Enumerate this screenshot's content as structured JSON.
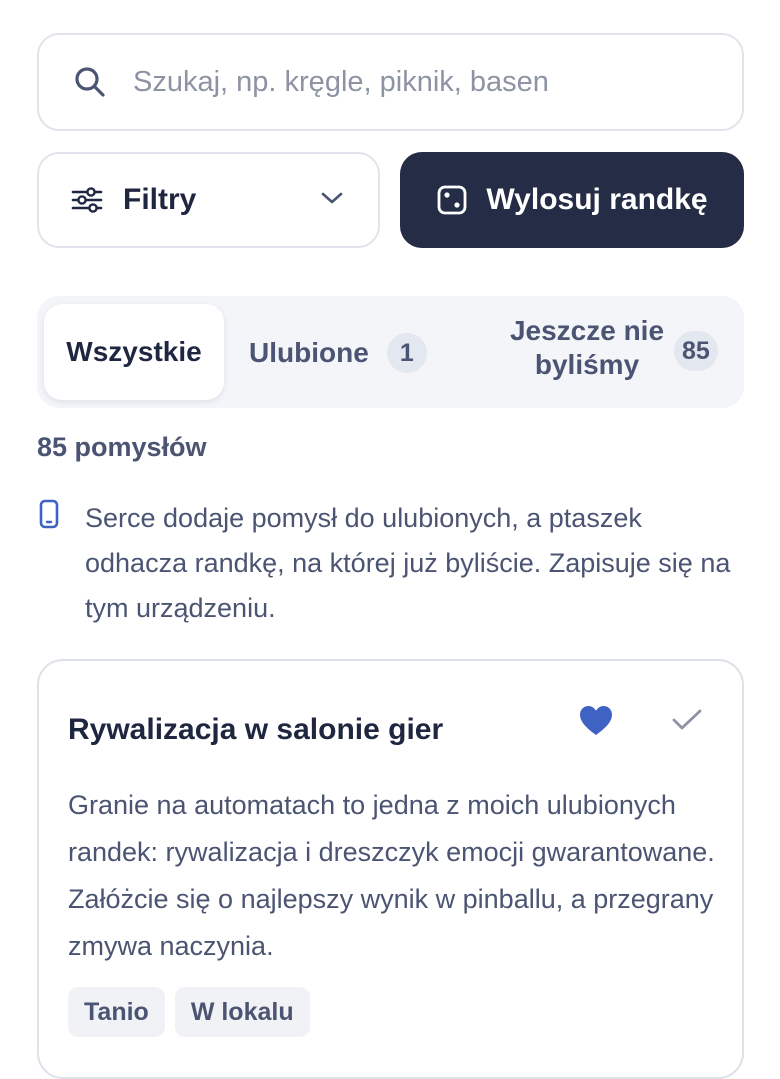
{
  "search": {
    "placeholder": "Szukaj, np. kręgle, piknik, basen",
    "icon": "search-icon"
  },
  "toolbar": {
    "filters_label": "Filtry",
    "draw_label": "Wylosuj randkę"
  },
  "tabs": [
    {
      "label": "Wszystkie",
      "active": true
    },
    {
      "label": "Ulubione",
      "count": "1"
    },
    {
      "label": "Jeszcze nie byliśmy",
      "count": "85"
    }
  ],
  "results": {
    "count_text": "85 pomysłów"
  },
  "info": {
    "text": "Serce dodaje pomysł do ulubionych, a ptaszek odhacza randkę, na której już byliście. Zapisuje się na tym urządzeniu."
  },
  "card": {
    "title": "Rywalizacja w salonie gier",
    "description": "Granie na automatach to jedna z moich ulubionych randek: rywalizacja i dreszczyk emocji gwarantowane. Załóżcie się o najlepszy wynik w pinballu, a przegrany zmywa naczynia.",
    "favorited": true,
    "tags": [
      "Tanio",
      "W lokalu"
    ]
  },
  "colors": {
    "primary_dark": "#252c45",
    "text_dark": "#1f2640",
    "text_muted": "#4b5472",
    "heart": "#3f63c2",
    "border": "#e1e4ec"
  }
}
